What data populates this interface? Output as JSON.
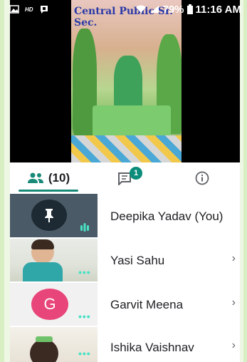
{
  "status_bar": {
    "battery": "79%",
    "time": "11:16 AM",
    "hd_label": "HD"
  },
  "video": {
    "banner_text": "Central Public Sr. Sec."
  },
  "tabs": {
    "people_count": "(10)",
    "chat_badge": "1"
  },
  "participants": [
    {
      "name": "Deepika Yadav (You)",
      "thumb": "pinned",
      "chevron": false
    },
    {
      "name": "Yasi Sahu",
      "thumb": "video",
      "chevron": true
    },
    {
      "name": "Garvit Meena",
      "thumb": "avatar",
      "avatar_letter": "G",
      "chevron": true
    },
    {
      "name": "Ishika Vaishnav",
      "thumb": "video",
      "chevron": true
    }
  ],
  "colors": {
    "accent": "#1a8a78",
    "avatar_pink": "#e8457a",
    "audio_teal": "#48e2c4"
  },
  "icons": {
    "people_tab": "people-icon",
    "chat_tab": "chat-icon",
    "info_tab": "info-icon",
    "pin": "pin-icon",
    "chevron": "chevron-right-icon"
  },
  "chevron_glyph": "›"
}
